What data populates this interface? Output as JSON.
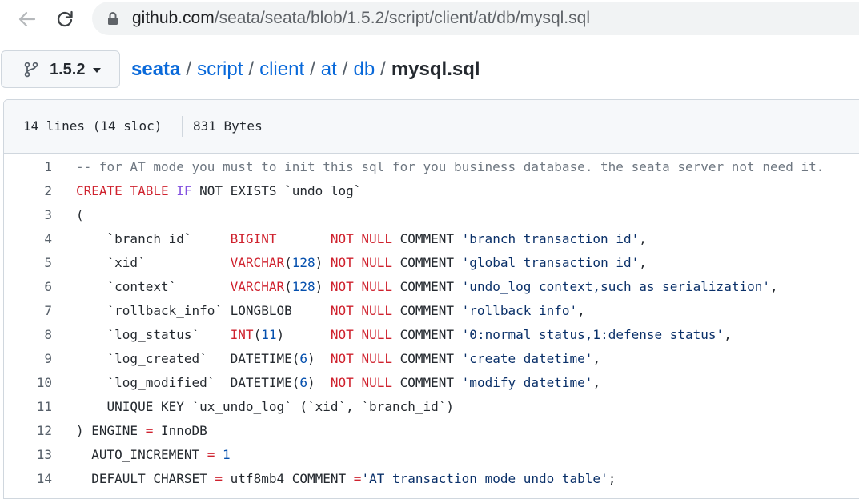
{
  "browser": {
    "url_host": "github.com",
    "url_path": "/seata/seata/blob/1.5.2/script/client/at/db/mysql.sql",
    "icons": {
      "back": "arrow-left-icon",
      "reload": "reload-icon",
      "lock": "lock-icon"
    }
  },
  "repo": {
    "branch": "1.5.2",
    "breadcrumb": {
      "root": "seata",
      "parts": [
        "script",
        "client",
        "at",
        "db"
      ],
      "separator": "/",
      "file": "mysql.sql"
    }
  },
  "file": {
    "line_info": "14 lines (14 sloc)",
    "size": "831 Bytes"
  },
  "colors": {
    "link": "#0969da",
    "keyword": "#cf222e",
    "function": "#8250df",
    "number": "#0550ae",
    "string": "#0a3069",
    "comment": "#6e7781"
  },
  "code_lines": [
    {
      "n": "1",
      "tokens": [
        [
          "c",
          "-- for AT mode you must to init this sql for you business database. the seata server not need it."
        ]
      ]
    },
    {
      "n": "2",
      "tokens": [
        [
          "k",
          "CREATE TABLE "
        ],
        [
          "f",
          "IF"
        ],
        [
          "p",
          " NOT EXISTS `undo_log`"
        ]
      ]
    },
    {
      "n": "3",
      "tokens": [
        [
          "p",
          "("
        ]
      ]
    },
    {
      "n": "4",
      "tokens": [
        [
          "p",
          "    `branch_id`     "
        ],
        [
          "k",
          "BIGINT"
        ],
        [
          "p",
          "       "
        ],
        [
          "k",
          "NOT NULL"
        ],
        [
          "p",
          " COMMENT "
        ],
        [
          "s",
          "'branch transaction id'"
        ],
        [
          "p",
          ","
        ]
      ]
    },
    {
      "n": "5",
      "tokens": [
        [
          "p",
          "    `xid`           "
        ],
        [
          "k",
          "VARCHAR"
        ],
        [
          "p",
          "("
        ],
        [
          "n",
          "128"
        ],
        [
          "p",
          ") "
        ],
        [
          "k",
          "NOT NULL"
        ],
        [
          "p",
          " COMMENT "
        ],
        [
          "s",
          "'global transaction id'"
        ],
        [
          "p",
          ","
        ]
      ]
    },
    {
      "n": "6",
      "tokens": [
        [
          "p",
          "    `context`       "
        ],
        [
          "k",
          "VARCHAR"
        ],
        [
          "p",
          "("
        ],
        [
          "n",
          "128"
        ],
        [
          "p",
          ") "
        ],
        [
          "k",
          "NOT NULL"
        ],
        [
          "p",
          " COMMENT "
        ],
        [
          "s",
          "'undo_log context,such as serialization'"
        ],
        [
          "p",
          ","
        ]
      ]
    },
    {
      "n": "7",
      "tokens": [
        [
          "p",
          "    `rollback_info` LONGBLOB     "
        ],
        [
          "k",
          "NOT NULL"
        ],
        [
          "p",
          " COMMENT "
        ],
        [
          "s",
          "'rollback info'"
        ],
        [
          "p",
          ","
        ]
      ]
    },
    {
      "n": "8",
      "tokens": [
        [
          "p",
          "    `log_status`    "
        ],
        [
          "k",
          "INT"
        ],
        [
          "p",
          "("
        ],
        [
          "n",
          "11"
        ],
        [
          "p",
          ")      "
        ],
        [
          "k",
          "NOT NULL"
        ],
        [
          "p",
          " COMMENT "
        ],
        [
          "s",
          "'0:normal status,1:defense status'"
        ],
        [
          "p",
          ","
        ]
      ]
    },
    {
      "n": "9",
      "tokens": [
        [
          "p",
          "    `log_created`   DATETIME("
        ],
        [
          "n",
          "6"
        ],
        [
          "p",
          ")  "
        ],
        [
          "k",
          "NOT NULL"
        ],
        [
          "p",
          " COMMENT "
        ],
        [
          "s",
          "'create datetime'"
        ],
        [
          "p",
          ","
        ]
      ]
    },
    {
      "n": "10",
      "tokens": [
        [
          "p",
          "    `log_modified`  DATETIME("
        ],
        [
          "n",
          "6"
        ],
        [
          "p",
          ")  "
        ],
        [
          "k",
          "NOT NULL"
        ],
        [
          "p",
          " COMMENT "
        ],
        [
          "s",
          "'modify datetime'"
        ],
        [
          "p",
          ","
        ]
      ]
    },
    {
      "n": "11",
      "tokens": [
        [
          "p",
          "    UNIQUE KEY `ux_undo_log` (`xid`, `branch_id`)"
        ]
      ]
    },
    {
      "n": "12",
      "tokens": [
        [
          "p",
          ") ENGINE "
        ],
        [
          "k",
          "="
        ],
        [
          "p",
          " InnoDB"
        ]
      ]
    },
    {
      "n": "13",
      "tokens": [
        [
          "p",
          "  AUTO_INCREMENT "
        ],
        [
          "k",
          "="
        ],
        [
          "p",
          " "
        ],
        [
          "n",
          "1"
        ]
      ]
    },
    {
      "n": "14",
      "tokens": [
        [
          "p",
          "  DEFAULT CHARSET "
        ],
        [
          "k",
          "="
        ],
        [
          "p",
          " utf8mb4 COMMENT "
        ],
        [
          "k",
          "="
        ],
        [
          "s",
          "'AT transaction mode undo table'"
        ],
        [
          "p",
          ";"
        ]
      ]
    }
  ]
}
